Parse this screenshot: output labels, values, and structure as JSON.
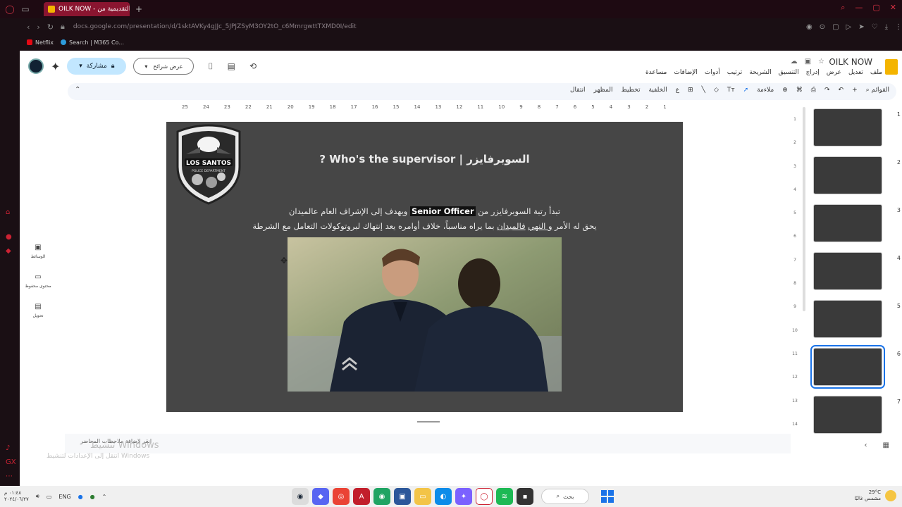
{
  "browser": {
    "tab_title": "OILK NOW - ي التقديمية من",
    "url": "docs.google.com/presentation/d/1sktAVKy4gJJc_5JPJZSyM3OY2tO_c6MmrgwttTXMD0I/edit",
    "bookmarks": [
      "Netflix",
      "Search | M365 Co..."
    ]
  },
  "header": {
    "doc_title": "OILK NOW",
    "menu": [
      "ملف",
      "تعديل",
      "عرض",
      "إدراج",
      "التنسيق",
      "الشريحة",
      "ترتيب",
      "أدوات",
      "الإضافات",
      "مساعدة"
    ],
    "share_label": "مشاركة",
    "present_label": "عرض شرائح"
  },
  "toolbar": {
    "menus_label": "القوائم",
    "fit_label": "ملاءمة",
    "background_label": "الخلفية",
    "layout_label": "تخطيط",
    "theme_label": "المظهر",
    "transition_label": "انتقال"
  },
  "ruler_marks": [
    "25",
    "24",
    "23",
    "22",
    "21",
    "20",
    "19",
    "18",
    "17",
    "16",
    "15",
    "14",
    "13",
    "12",
    "11",
    "10",
    "9",
    "8",
    "7",
    "6",
    "5",
    "4",
    "3",
    "2",
    "1"
  ],
  "vruler_marks": [
    "1",
    "2",
    "3",
    "4",
    "5",
    "6",
    "7",
    "8",
    "9",
    "10",
    "11",
    "12",
    "13",
    "14"
  ],
  "side_panel": {
    "media_label": "الوسائط",
    "saved_label": "محتوى محفوظ",
    "convert_label": "تحويل"
  },
  "slide": {
    "badge_line1": "LOS SANTOS",
    "badge_line2": "POLICE DEPARTMENT",
    "title": "السوبرفايزر | Who's the supervisor ?",
    "line1_pre": "تبدأ رتبة السوبرفايزر من",
    "line1_highlight": "Senior Officer",
    "line1_post": "ويهدف إلى الإشراف العام عالميدان",
    "line2_pre": "يحق له الأمر",
    "line2_ul1": "و النهي",
    "line2_ul2": "فالميدان",
    "line2_post": "بما يراه مناسباً، خلاف أوامره يعد إنتهاك لبروتوكولات التعامل مع الشرطة"
  },
  "thumbnails": [
    {
      "number": "1"
    },
    {
      "number": "2"
    },
    {
      "number": "3"
    },
    {
      "number": "4"
    },
    {
      "number": "5"
    },
    {
      "number": "6",
      "active": true
    },
    {
      "number": "7"
    }
  ],
  "notes": {
    "placeholder": "انقر لإضافة ملاحظات المحاضر"
  },
  "windows_activation": {
    "title": "تنشيط Windows",
    "subtitle": "انتقل إلى الإعدادات لتنشيط Windows"
  },
  "taskbar": {
    "lang": "ENG",
    "time": "٠١:٤٨ م",
    "date": "٢٠٢٤/٠٦/٢٧",
    "search_label": "بحث",
    "temp": "29°C",
    "weather": "مشمس غالبًا"
  },
  "colors": {
    "slide_bg": "#464646",
    "share_bg": "#c2e7ff",
    "accent": "#1a73e8",
    "tab": "#8a1530"
  }
}
